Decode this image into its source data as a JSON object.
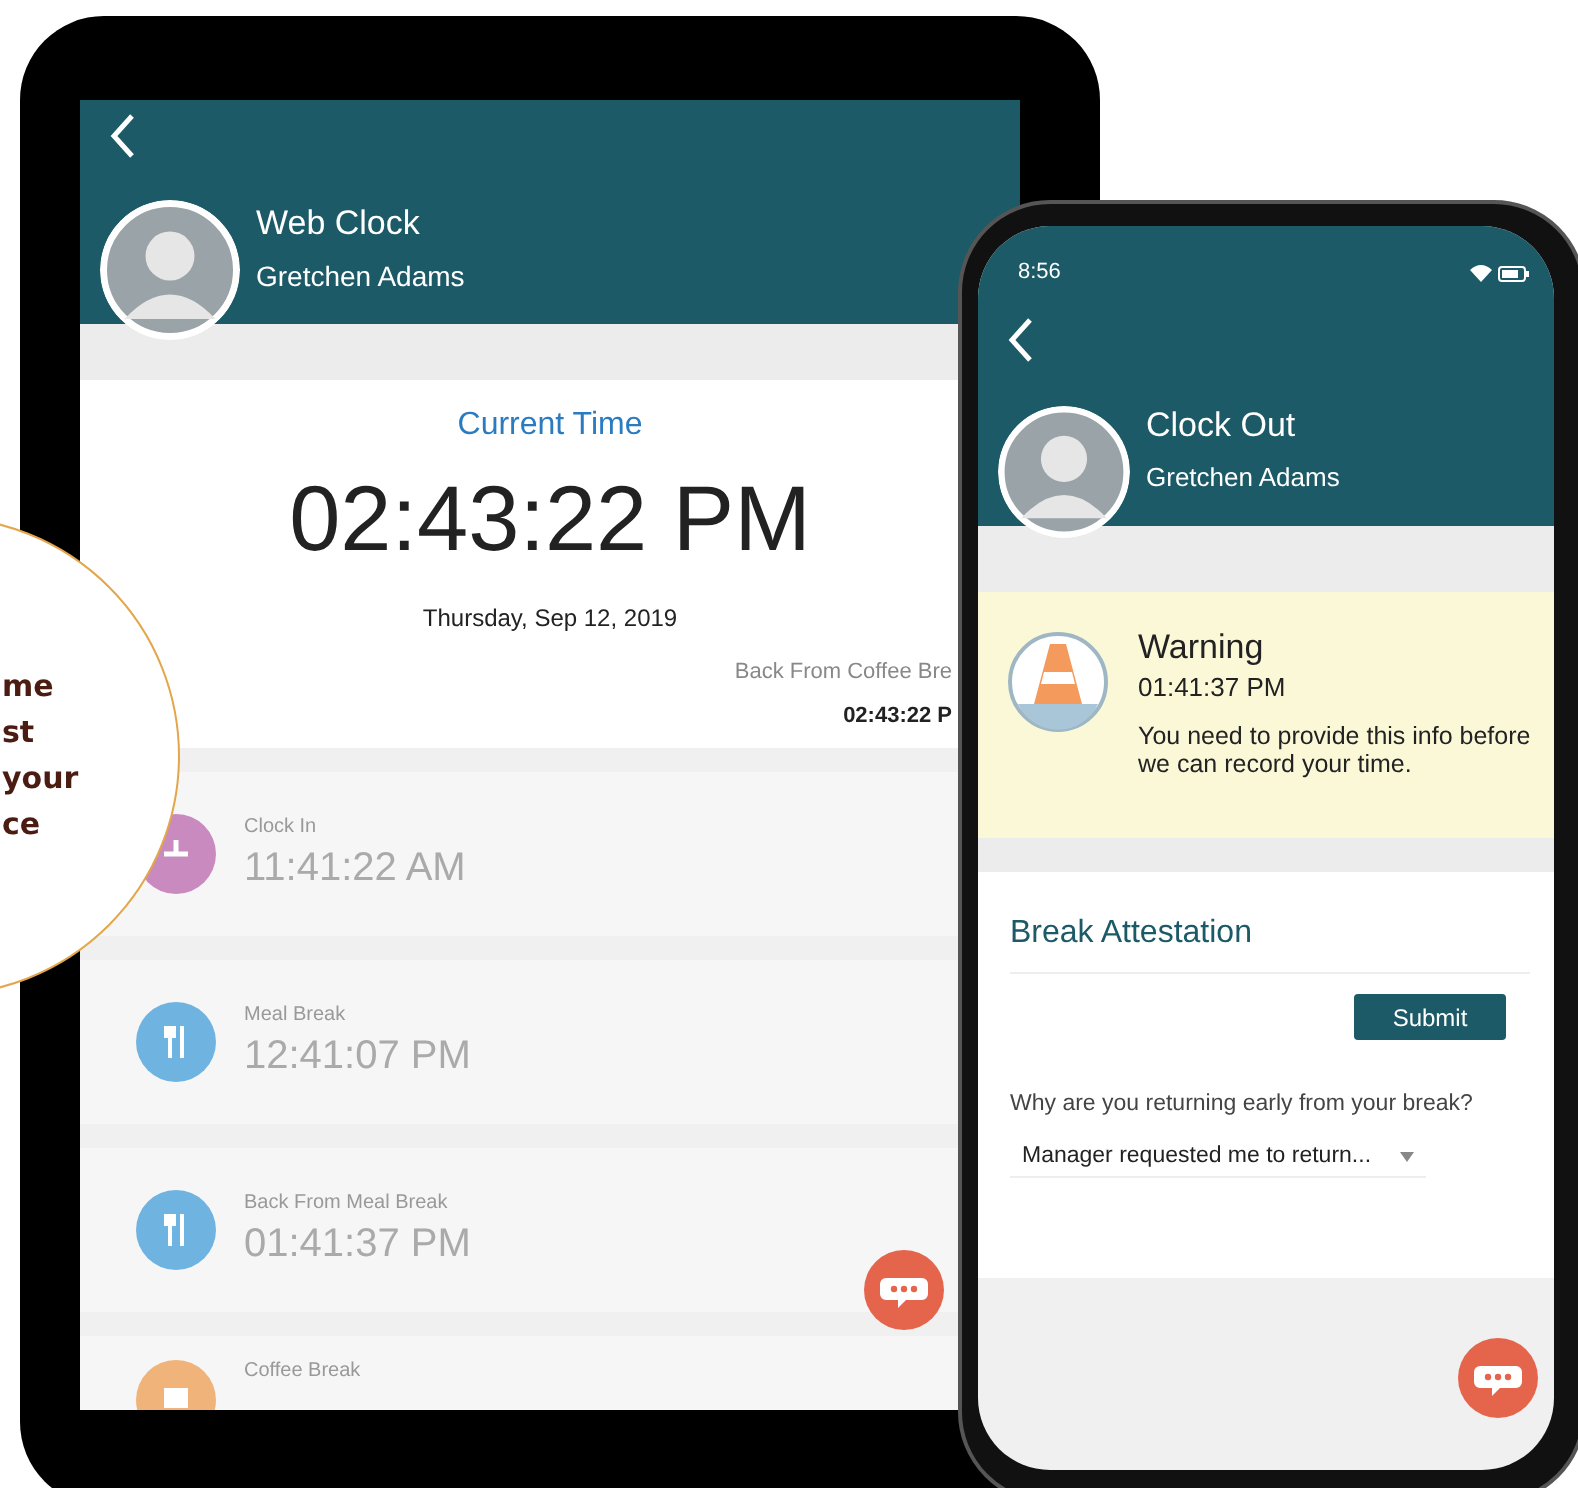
{
  "callout": {
    "lines": [
      "me",
      "st",
      "your",
      "ce"
    ]
  },
  "tablet": {
    "header": {
      "title": "Web Clock",
      "user": "Gretchen Adams"
    },
    "current": {
      "heading": "Current Time",
      "time": "02:43:22 PM",
      "date": "Thursday, Sep 12, 2019",
      "last_label": "Back From Coffee Bre",
      "last_time": "02:43:22 P"
    },
    "entries": [
      {
        "kind": "clock",
        "color": "#c98ac0",
        "label": "Clock In",
        "time": "11:41:22 AM"
      },
      {
        "kind": "meal",
        "color": "#6fb3e0",
        "label": "Meal Break",
        "time": "12:41:07 PM"
      },
      {
        "kind": "meal",
        "color": "#6fb3e0",
        "label": "Back From Meal Break",
        "time": "01:41:37 PM"
      },
      {
        "kind": "coffee",
        "color": "#f0b47a",
        "label": "Coffee Break"
      }
    ]
  },
  "phone": {
    "status_time": "8:56",
    "header": {
      "title": "Clock Out",
      "user": "Gretchen Adams"
    },
    "warning": {
      "title": "Warning",
      "time": "01:41:37 PM",
      "message": "You need to provide this info before we can record your time."
    },
    "form": {
      "title": "Break Attestation",
      "submit": "Submit",
      "question": "Why are you returning early from your break?",
      "answer": "Manager requested me to return..."
    }
  }
}
